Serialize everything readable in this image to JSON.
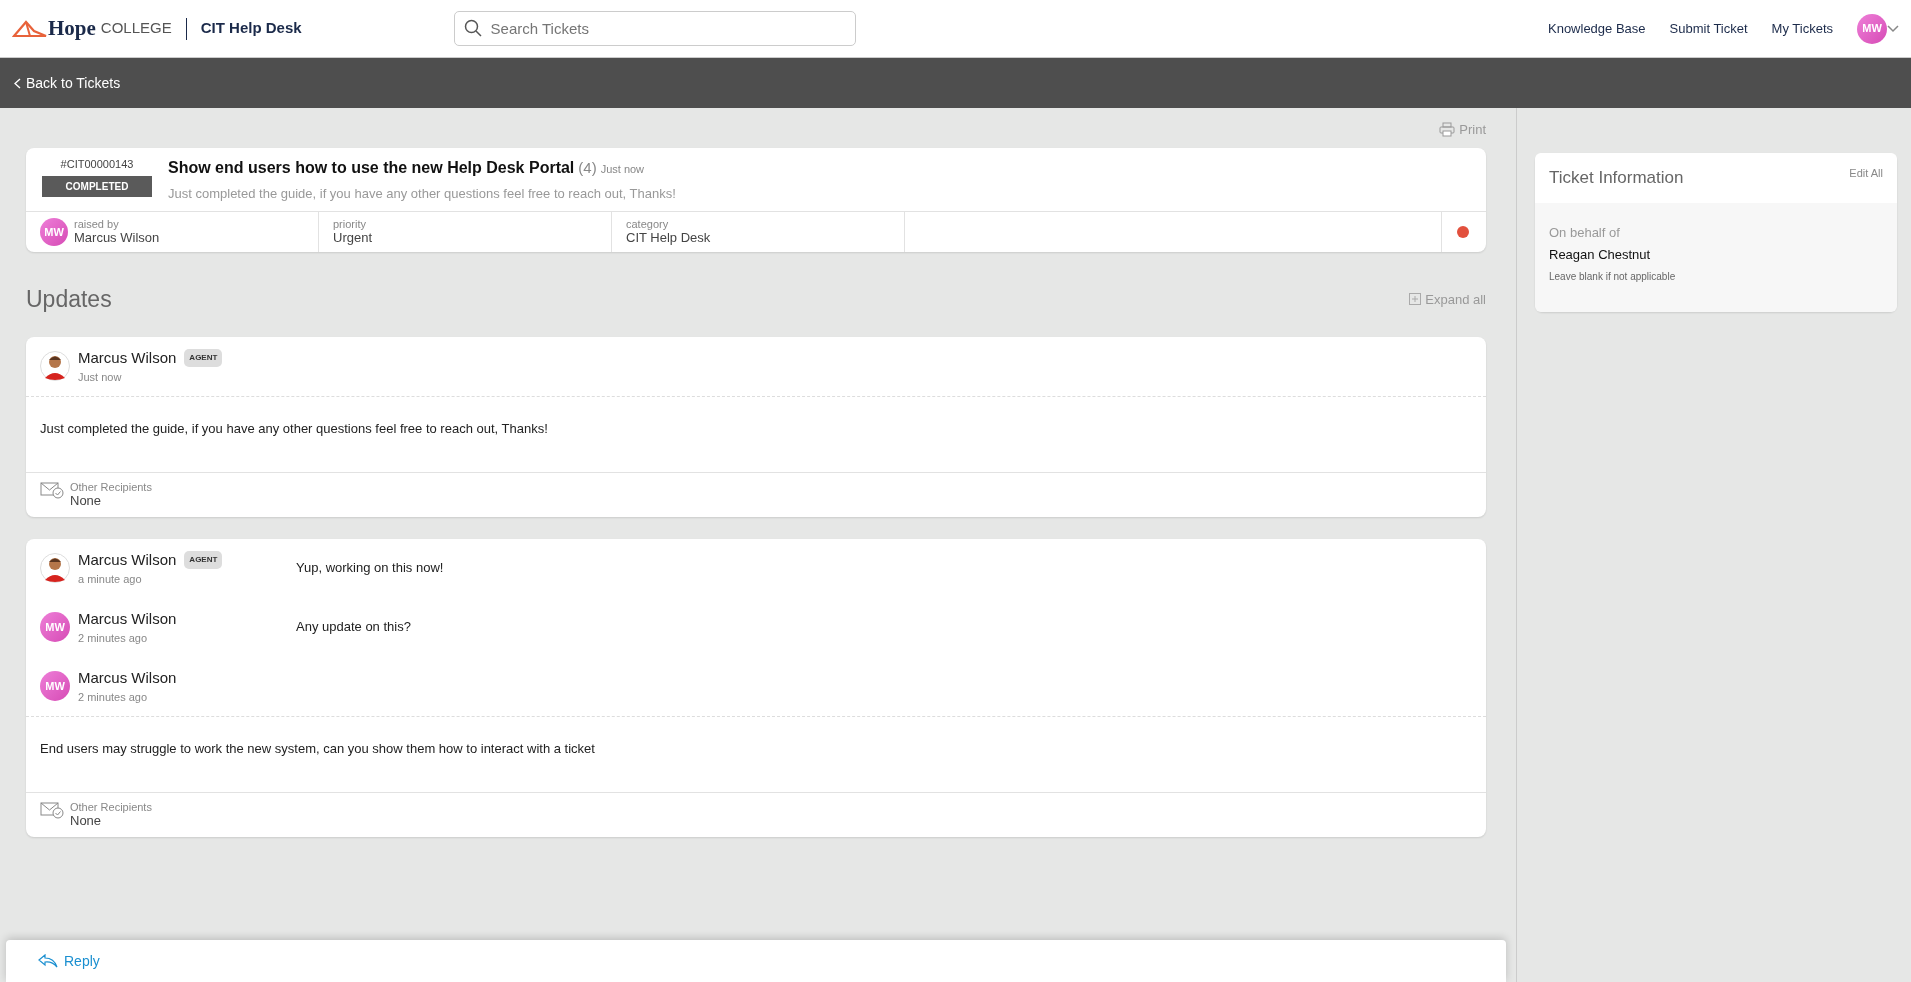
{
  "header": {
    "brand_name": "Hope",
    "brand_sub": "COLLEGE",
    "app_title": "CIT Help Desk",
    "search": {
      "placeholder": "Search Tickets"
    },
    "nav_links": [
      "Knowledge Base",
      "Submit Ticket",
      "My Tickets"
    ],
    "user_initials": "MW"
  },
  "back_link": "Back to Tickets",
  "print_label": "Print",
  "ticket": {
    "number": "#CIT00000143",
    "status": "COMPLETED",
    "title": "Show end users how to use the new Help Desk Portal",
    "count": "(4)",
    "time": "Just now",
    "summary": "Just completed the guide, if you have any other questions feel free to reach out, Thanks!",
    "fields": [
      {
        "label": "raised by",
        "value": "Marcus Wilson",
        "initials": "MW"
      },
      {
        "label": "priority",
        "value": "Urgent"
      },
      {
        "label": "category",
        "value": "CIT Help Desk"
      }
    ]
  },
  "updates_title": "Updates",
  "expand_all": "Expand all",
  "threads": [
    {
      "items": [
        {
          "author": "Marcus Wilson",
          "kind": "figure",
          "badge": "AGENT",
          "time": "Just now",
          "expanded": true,
          "message": "Just completed the guide, if you have any other questions feel free to reach out, Thanks!",
          "recipients_label": "Other Recipients",
          "recipients": "None"
        }
      ]
    },
    {
      "items": [
        {
          "author": "Marcus Wilson",
          "kind": "figure",
          "badge": "AGENT",
          "time": "a minute ago",
          "expanded": false,
          "message": "Yup, working on this now!"
        },
        {
          "author": "Marcus Wilson",
          "kind": "initials",
          "initials": "MW",
          "time": "2 minutes ago",
          "expanded": false,
          "message": "Any update on this?"
        },
        {
          "author": "Marcus Wilson",
          "kind": "initials",
          "initials": "MW",
          "time": "2 minutes ago",
          "expanded": true,
          "message": "End users may struggle to work the new system, can you show them how to interact with a ticket",
          "recipients_label": "Other Recipients",
          "recipients": "None"
        }
      ]
    }
  ],
  "reply_label": "Reply",
  "sidebar": {
    "title": "Ticket Information",
    "edit_all": "Edit All",
    "field_label": "On behalf of",
    "field_value": "Reagan Chestnut",
    "field_hint": "Leave blank if not applicable"
  }
}
